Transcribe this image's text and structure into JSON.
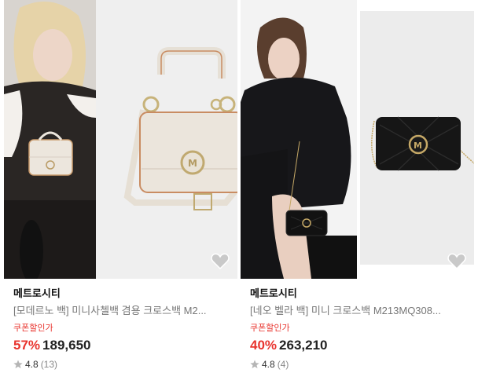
{
  "products": [
    {
      "brand": "메트로시티",
      "title": "[모데르노 백] 미니사첼백 겸용 크로스백 M2...",
      "price_label": "쿠폰할인가",
      "discount": "57%",
      "price": "189,650",
      "rating": "4.8",
      "review_count": "(13)",
      "wishlist_icon": "heart-icon",
      "bag_color": "#ebe5dc"
    },
    {
      "brand": "메트로시티",
      "title": "[네오 벨라 백] 미니 크로스백 M213MQ308...",
      "price_label": "쿠폰할인가",
      "discount": "40%",
      "price": "263,210",
      "rating": "4.8",
      "review_count": "(4)",
      "wishlist_icon": "heart-icon",
      "bag_color": "#161616"
    }
  ],
  "colors": {
    "discount": "#e8342e",
    "price_label": "#e8342e"
  }
}
